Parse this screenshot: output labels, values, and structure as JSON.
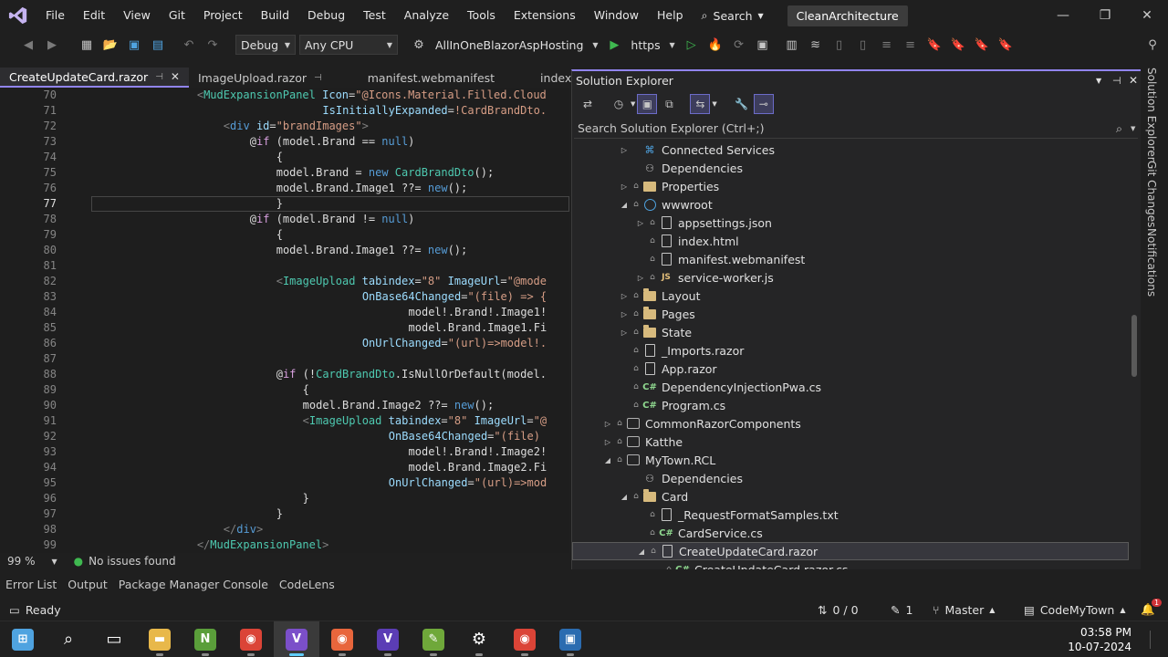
{
  "menu": [
    "File",
    "Edit",
    "View",
    "Git",
    "Project",
    "Build",
    "Debug",
    "Test",
    "Analyze",
    "Tools",
    "Extensions",
    "Window",
    "Help"
  ],
  "search_label": "Search",
  "solution_name": "CleanArchitecture",
  "toolbar": {
    "config": "Debug",
    "platform": "Any CPU",
    "startup_project": "AllInOneBlazorAspHosting",
    "run_target": "https"
  },
  "tabs": [
    {
      "label": "CreateUpdateCard.razor",
      "active": true
    },
    {
      "label": "ImageUpload.razor",
      "active": false
    },
    {
      "label": "manifest.webmanifest",
      "active": false
    },
    {
      "label": "index.html",
      "active": false
    }
  ],
  "code": [
    {
      "ln": "70",
      "html": "<span class='t-bracket'>&lt;</span><span class='t-tag'>MudExpansionPanel</span> <span class='t-attr'>Icon</span>=<span class='t-str'>\"@Icons.Material.Filled.Cloud</span>",
      "indent": 16
    },
    {
      "ln": "71",
      "html": "<span class='t-attr'>IsInitiallyExpanded</span>=<span class='t-str'>!CardBrandDto.</span>",
      "indent": 35
    },
    {
      "ln": "72",
      "html": "<span class='t-bracket'>&lt;</span><span class='t-html'>div</span> <span class='t-attr'>id</span>=<span class='t-str'>\"brandImages\"</span><span class='t-bracket'>&gt;</span>",
      "indent": 20
    },
    {
      "ln": "73",
      "html": "<span class='t-razor'>@</span><span class='t-ctl'>if</span> <span class='t-txt'>(model.Brand == </span><span class='t-kw'>null</span><span class='t-txt'>)</span>",
      "indent": 24
    },
    {
      "ln": "74",
      "html": "<span class='t-txt'>{</span>",
      "indent": 28
    },
    {
      "ln": "75",
      "html": "<span class='t-txt'>model.Brand = </span><span class='t-kw'>new</span> <span class='t-type'>CardBrandDto</span><span class='t-txt'>();</span>",
      "indent": 28
    },
    {
      "ln": "76",
      "html": "<span class='t-txt'>model.Brand.Image1 ??= </span><span class='t-kw'>new</span><span class='t-txt'>();</span>",
      "indent": 28
    },
    {
      "ln": "77",
      "html": "<span class='t-txt'>}</span>",
      "indent": 28
    },
    {
      "ln": "78",
      "html": "<span class='t-razor'>@</span><span class='t-ctl'>if</span> <span class='t-txt'>(model.Brand != </span><span class='t-kw'>null</span><span class='t-txt'>)</span>",
      "indent": 24
    },
    {
      "ln": "79",
      "html": "<span class='t-txt'>{</span>",
      "indent": 28
    },
    {
      "ln": "80",
      "html": "<span class='t-txt'>model.Brand.Image1 ??= </span><span class='t-kw'>new</span><span class='t-txt'>();</span>",
      "indent": 28
    },
    {
      "ln": "81",
      "html": "",
      "indent": 0
    },
    {
      "ln": "82",
      "html": "<span class='t-bracket'>&lt;</span><span class='t-tag'>ImageUpload</span> <span class='t-attr'>tabindex</span>=<span class='t-str'>\"8\"</span> <span class='t-attr'>ImageUrl</span>=<span class='t-str'>\"@mode</span>",
      "indent": 28
    },
    {
      "ln": "83",
      "html": "<span class='t-attr'>OnBase64Changed</span>=<span class='t-str'>\"(file) =&gt; {</span>",
      "indent": 41
    },
    {
      "ln": "84",
      "html": "<span class='t-txt'>model!.Brand!.Image1!</span>",
      "indent": 48
    },
    {
      "ln": "85",
      "html": "<span class='t-txt'>model.Brand.Image1.Fi</span>",
      "indent": 48
    },
    {
      "ln": "86",
      "html": "<span class='t-attr'>OnUrlChanged</span>=<span class='t-str'>\"(url)=&gt;model!.</span>",
      "indent": 41
    },
    {
      "ln": "87",
      "html": "",
      "indent": 0
    },
    {
      "ln": "88",
      "html": "<span class='t-razor'>@</span><span class='t-ctl'>if</span> <span class='t-txt'>(!</span><span class='t-type'>CardBrandDto</span><span class='t-txt'>.IsNullOrDefault(model.</span>",
      "indent": 28
    },
    {
      "ln": "89",
      "html": "<span class='t-txt'>{</span>",
      "indent": 32
    },
    {
      "ln": "90",
      "html": "<span class='t-txt'>model.Brand.Image2 ??= </span><span class='t-kw'>new</span><span class='t-txt'>();</span>",
      "indent": 32
    },
    {
      "ln": "91",
      "html": "<span class='t-bracket'>&lt;</span><span class='t-tag'>ImageUpload</span> <span class='t-attr'>tabindex</span>=<span class='t-str'>\"8\"</span> <span class='t-attr'>ImageUrl</span>=<span class='t-str'>\"@</span>",
      "indent": 32
    },
    {
      "ln": "92",
      "html": "<span class='t-attr'>OnBase64Changed</span>=<span class='t-str'>\"(file) </span>",
      "indent": 45
    },
    {
      "ln": "93",
      "html": "<span class='t-txt'>model!.Brand!.Image2!</span>",
      "indent": 48
    },
    {
      "ln": "94",
      "html": "<span class='t-txt'>model.Brand.Image2.Fi</span>",
      "indent": 48
    },
    {
      "ln": "95",
      "html": "<span class='t-attr'>OnUrlChanged</span>=<span class='t-str'>\"(url)=&gt;mod</span>",
      "indent": 45
    },
    {
      "ln": "96",
      "html": "<span class='t-txt'>}</span>",
      "indent": 32
    },
    {
      "ln": "97",
      "html": "<span class='t-txt'>}</span>",
      "indent": 28
    },
    {
      "ln": "98",
      "html": "<span class='t-bracket'>&lt;/</span><span class='t-html'>div</span><span class='t-bracket'>&gt;</span>",
      "indent": 20
    },
    {
      "ln": "99",
      "html": "<span class='t-bracket'>&lt;/</span><span class='t-tag'>MudExpansionPanel</span><span class='t-bracket'>&gt;</span>",
      "indent": 16
    }
  ],
  "current_line": "77",
  "editor_status": {
    "zoom": "99 %",
    "issues": "No issues found"
  },
  "bottom_tabs": [
    "Error List",
    "Output",
    "Package Manager Console",
    "CodeLens"
  ],
  "solution_explorer": {
    "title": "Solution Explorer",
    "search_placeholder": "Search Solution Explorer (Ctrl+;)",
    "nodes": [
      {
        "label": "Connected Services",
        "depth": 2,
        "exp": "▷",
        "lock": "",
        "icon": "conn"
      },
      {
        "label": "Dependencies",
        "depth": 2,
        "exp": "",
        "lock": "",
        "icon": "deps"
      },
      {
        "label": "Properties",
        "depth": 2,
        "exp": "▷",
        "lock": "🔒",
        "icon": "props"
      },
      {
        "label": "wwwroot",
        "depth": 2,
        "exp": "◢",
        "lock": "🔒",
        "icon": "globe"
      },
      {
        "label": "appsettings.json",
        "depth": 3,
        "exp": "▷",
        "lock": "🔒",
        "icon": "file"
      },
      {
        "label": "index.html",
        "depth": 3,
        "exp": "",
        "lock": "🔒",
        "icon": "file"
      },
      {
        "label": "manifest.webmanifest",
        "depth": 3,
        "exp": "",
        "lock": "🔒",
        "icon": "file"
      },
      {
        "label": "service-worker.js",
        "depth": 3,
        "exp": "▷",
        "lock": "🔒",
        "icon": "js"
      },
      {
        "label": "Layout",
        "depth": 2,
        "exp": "▷",
        "lock": "🔒",
        "icon": "folder"
      },
      {
        "label": "Pages",
        "depth": 2,
        "exp": "▷",
        "lock": "🔒",
        "icon": "folder"
      },
      {
        "label": "State",
        "depth": 2,
        "exp": "▷",
        "lock": "🔒",
        "icon": "folder"
      },
      {
        "label": "_Imports.razor",
        "depth": 2,
        "exp": "",
        "lock": "🔒",
        "icon": "file"
      },
      {
        "label": "App.razor",
        "depth": 2,
        "exp": "",
        "lock": "🔒",
        "icon": "file"
      },
      {
        "label": "DependencyInjectionPwa.cs",
        "depth": 2,
        "exp": "",
        "lock": "🔒",
        "icon": "cs"
      },
      {
        "label": "Program.cs",
        "depth": 2,
        "exp": "",
        "lock": "🔒",
        "icon": "cs"
      },
      {
        "label": "CommonRazorComponents",
        "depth": 1,
        "exp": "▷",
        "lock": "🔒",
        "icon": "proj"
      },
      {
        "label": "Katthe",
        "depth": 1,
        "exp": "▷",
        "lock": "🔒",
        "icon": "proj"
      },
      {
        "label": "MyTown.RCL",
        "depth": 1,
        "exp": "◢",
        "lock": "🔒",
        "icon": "proj"
      },
      {
        "label": "Dependencies",
        "depth": 2,
        "exp": "",
        "lock": "",
        "icon": "deps"
      },
      {
        "label": "Card",
        "depth": 2,
        "exp": "◢",
        "lock": "🔒",
        "icon": "folder"
      },
      {
        "label": "_RequestFormatSamples.txt",
        "depth": 3,
        "exp": "",
        "lock": "🔒",
        "icon": "file"
      },
      {
        "label": "CardService.cs",
        "depth": 3,
        "exp": "",
        "lock": "🔒",
        "icon": "cs"
      },
      {
        "label": "CreateUpdateCard.razor",
        "depth": 3,
        "exp": "◢",
        "lock": "🔒",
        "icon": "file",
        "selected": true
      },
      {
        "label": "CreateUpdateCard.razor.cs",
        "depth": 4,
        "exp": "",
        "lock": "🔒",
        "icon": "cs"
      }
    ]
  },
  "rail_tabs": [
    "Solution Explorer",
    "Git Changes",
    "Notifications"
  ],
  "statusbar": {
    "ready": "Ready",
    "sync": "0 / 0",
    "edits": "1",
    "branch": "Master",
    "repo": "CodeMyTown",
    "notif_count": "1"
  },
  "clock": {
    "time": "03:58 PM",
    "date": "10-07-2024"
  },
  "taskbar_apps": [
    {
      "name": "windows-start",
      "color": "#4fa3e0",
      "glyph": "⊞"
    },
    {
      "name": "search",
      "color": "transparent",
      "glyph": "⌕"
    },
    {
      "name": "task-view",
      "color": "transparent",
      "glyph": "▭"
    },
    {
      "name": "file-explorer",
      "color": "#e8b84a",
      "glyph": "▬"
    },
    {
      "name": "notepad-plus-plus",
      "color": "#5a9e3a",
      "glyph": "N"
    },
    {
      "name": "chrome",
      "color": "#db4437",
      "glyph": "◉"
    },
    {
      "name": "visual-studio",
      "color": "#7b4fc9",
      "glyph": "V",
      "active": true
    },
    {
      "name": "firefox",
      "color": "#e8663c",
      "glyph": "◉"
    },
    {
      "name": "visual-studio-preview",
      "color": "#5b3db5",
      "glyph": "V"
    },
    {
      "name": "vs-installer",
      "color": "#6fa83a",
      "glyph": "✎"
    },
    {
      "name": "settings",
      "color": "transparent",
      "glyph": "⚙"
    },
    {
      "name": "chrome-2",
      "color": "#db4437",
      "glyph": "◉"
    },
    {
      "name": "remote-app",
      "color": "#2b6cb0",
      "glyph": "▣"
    }
  ]
}
